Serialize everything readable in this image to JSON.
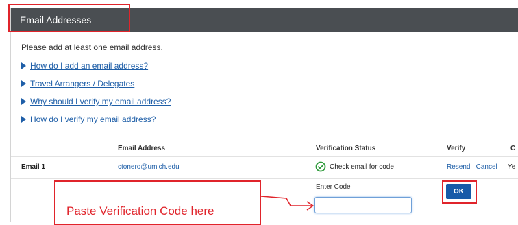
{
  "panel": {
    "title": "Email Addresses",
    "intro": "Please add at least one email address."
  },
  "help_links": [
    {
      "label": "How do I add an email address?",
      "icon": "triangle-right-icon"
    },
    {
      "label": "Travel Arrangers / Delegates",
      "icon": "triangle-right-icon"
    },
    {
      "label": "Why should I verify my email address?",
      "icon": "triangle-right-icon"
    },
    {
      "label": "How do I verify my email address?",
      "icon": "triangle-right-icon"
    }
  ],
  "table": {
    "headers": {
      "email": "Email Address",
      "status": "Verification Status",
      "verify": "Verify",
      "extra": "C"
    },
    "rows": [
      {
        "label": "Email 1",
        "email": "ctonero@umich.edu",
        "status_icon": "check-circle-icon",
        "status": "Check email for code",
        "resend": "Resend",
        "separator": "|",
        "cancel": "Cancel",
        "extra": "Ye"
      }
    ]
  },
  "verify_code": {
    "label": "Enter Code",
    "value": "",
    "placeholder": "",
    "ok_label": "OK"
  },
  "annotation": {
    "callout_text": "Paste Verification Code here"
  },
  "colors": {
    "header_bg": "#4a4e52",
    "link": "#1f5fa8",
    "highlight": "#e0242b",
    "button": "#175aa8",
    "status_icon": "#2e9a3a"
  }
}
